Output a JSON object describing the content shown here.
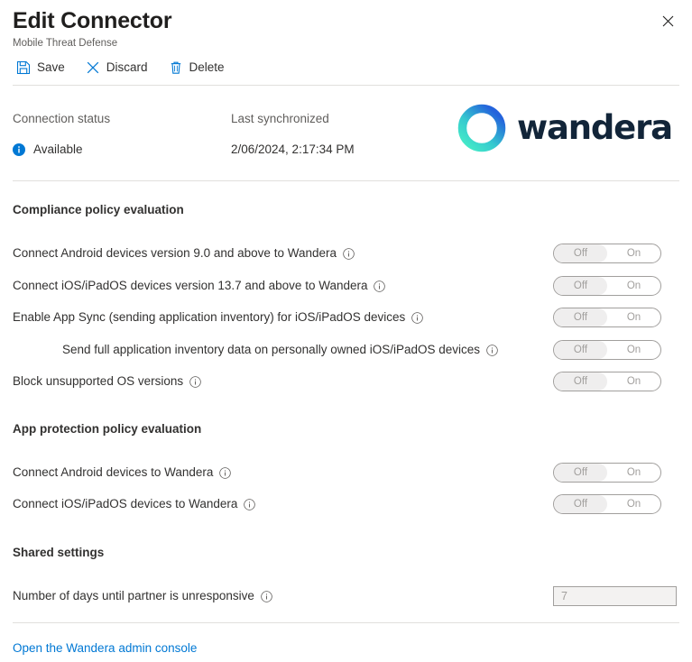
{
  "header": {
    "title": "Edit Connector",
    "subtitle": "Mobile Threat Defense",
    "close_icon": "close-icon"
  },
  "commandbar": {
    "items": [
      {
        "label": "Save",
        "icon": "save-icon"
      },
      {
        "label": "Discard",
        "icon": "discard-icon"
      },
      {
        "label": "Delete",
        "icon": "delete-icon"
      }
    ]
  },
  "status": {
    "connection_label": "Connection status",
    "connection_value": "Available",
    "connection_icon": "info-filled-icon",
    "last_sync_label": "Last synchronized",
    "last_sync_value": "2/06/2024, 2:17:34 PM"
  },
  "brand": {
    "name": "wandera",
    "ring_gradient_start": "#3ee0c4",
    "ring_gradient_end": "#2668d8",
    "wordmark_color": "#122539",
    "accent": "#0078d4"
  },
  "sections": {
    "compliance": {
      "title": "Compliance policy evaluation",
      "rows": [
        {
          "label": "Connect Android devices version 9.0 and above to Wandera",
          "info_icon": "info-outline-icon",
          "toggle": {
            "off": "Off",
            "on": "On",
            "state": "Off"
          }
        },
        {
          "label": "Connect iOS/iPadOS devices version 13.7 and above to Wandera",
          "info_icon": "info-outline-icon",
          "toggle": {
            "off": "Off",
            "on": "On",
            "state": "Off"
          }
        },
        {
          "label": "Enable App Sync (sending application inventory) for iOS/iPadOS devices",
          "info_icon": "info-outline-icon",
          "toggle": {
            "off": "Off",
            "on": "On",
            "state": "Off"
          }
        },
        {
          "label": "Send full application inventory data on personally owned iOS/iPadOS devices",
          "info_icon": "info-outline-icon",
          "indented": true,
          "toggle": {
            "off": "Off",
            "on": "On",
            "state": "Off"
          }
        },
        {
          "label": "Block unsupported OS versions",
          "info_icon": "info-outline-icon",
          "toggle": {
            "off": "Off",
            "on": "On",
            "state": "Off"
          }
        }
      ]
    },
    "app_protection": {
      "title": "App protection policy evaluation",
      "rows": [
        {
          "label": "Connect Android devices to Wandera",
          "info_icon": "info-outline-icon",
          "toggle": {
            "off": "Off",
            "on": "On",
            "state": "Off"
          }
        },
        {
          "label": "Connect iOS/iPadOS devices to Wandera",
          "info_icon": "info-outline-icon",
          "toggle": {
            "off": "Off",
            "on": "On",
            "state": "Off"
          }
        }
      ]
    },
    "shared": {
      "title": "Shared settings",
      "rows": [
        {
          "label": "Number of days until partner is unresponsive",
          "info_icon": "info-outline-icon",
          "input_value": "7"
        }
      ]
    }
  },
  "footer": {
    "link_label": "Open the Wandera admin console"
  }
}
